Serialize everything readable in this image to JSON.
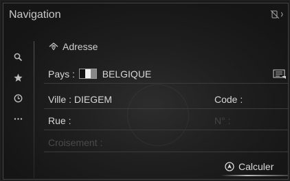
{
  "header": {
    "title": "Navigation"
  },
  "sidebar": {
    "items": [
      {
        "icon": "search-icon"
      },
      {
        "icon": "star-icon"
      },
      {
        "icon": "clock-icon"
      },
      {
        "icon": "more-icon"
      }
    ]
  },
  "section": {
    "title": "Adresse",
    "icon": "address-icon"
  },
  "form": {
    "pays_label": "Pays :",
    "pays_value": "BELGIQUE",
    "ville_label": "Ville : DIEGEM",
    "code_label": "Code :",
    "rue_label": "Rue :",
    "numero_label": "N° :",
    "croisement_label": "Croisement :"
  },
  "actions": {
    "calculate_label": "Calculer"
  }
}
